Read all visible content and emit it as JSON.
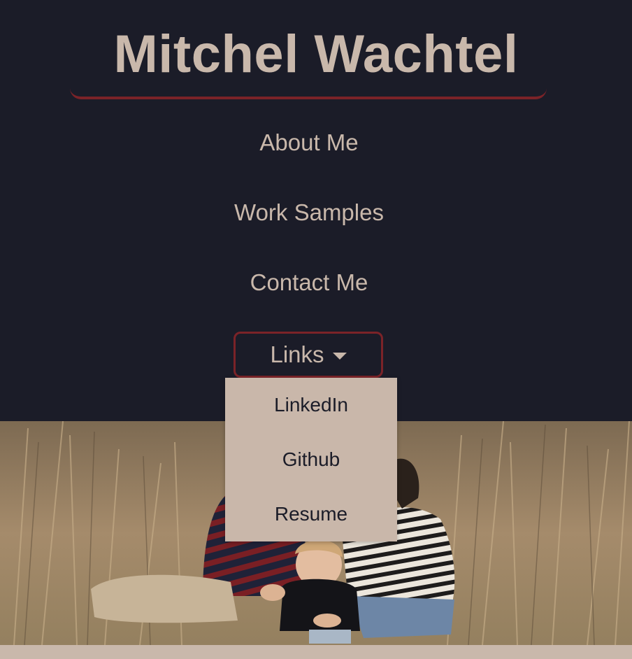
{
  "header": {
    "title": "Mitchel Wachtel"
  },
  "nav": {
    "about": "About Me",
    "work": "Work Samples",
    "contact": "Contact Me",
    "links": "Links"
  },
  "dropdown": {
    "items": [
      "LinkedIn",
      "Github",
      "Resume"
    ]
  },
  "colors": {
    "background": "#1b1c28",
    "text": "#c9b8ab",
    "accent": "#7b2328",
    "dropdown_bg": "#c9b7aa",
    "dropdown_text": "#1b1c28"
  },
  "icons": {
    "links_caret": "caret-down-icon"
  }
}
